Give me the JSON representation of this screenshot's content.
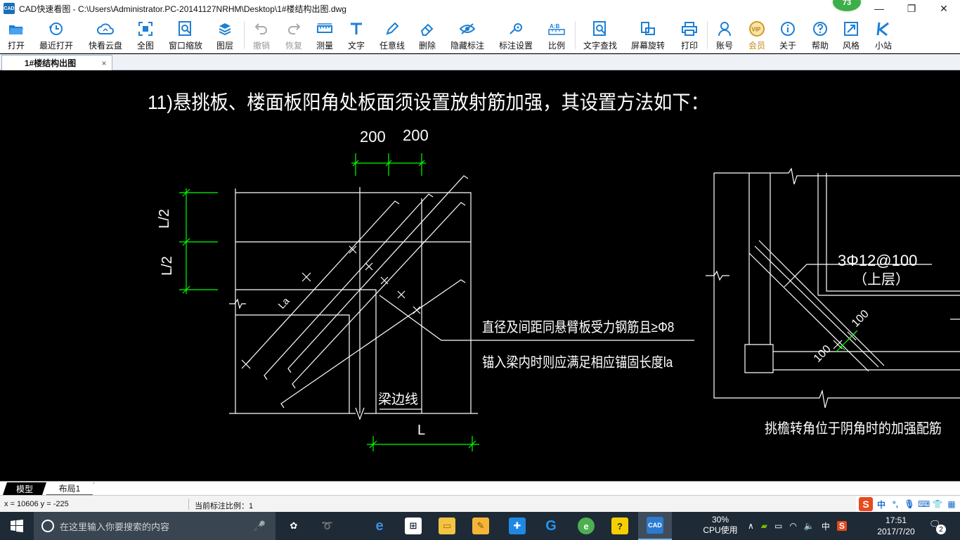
{
  "window": {
    "title": "CAD快速看图 - C:\\Users\\Administrator.PC-20141127NRHM\\Desktop\\1#楼结构出图.dwg",
    "badge": "73"
  },
  "toolbar": {
    "items": [
      {
        "label": "打开",
        "icon": "folder-open-icon"
      },
      {
        "label": "最近打开",
        "icon": "clock-icon"
      },
      {
        "label": "快看云盘",
        "icon": "cloud-icon"
      },
      {
        "label": "全图",
        "icon": "fit-all-icon"
      },
      {
        "label": "窗口缩放",
        "icon": "zoom-window-icon"
      },
      {
        "label": "图层",
        "icon": "layers-icon"
      },
      {
        "label": "撤销",
        "icon": "undo-icon"
      },
      {
        "label": "恢复",
        "icon": "redo-icon"
      },
      {
        "label": "测量",
        "icon": "ruler-icon"
      },
      {
        "label": "文字",
        "icon": "text-icon"
      },
      {
        "label": "任意线",
        "icon": "pen-icon"
      },
      {
        "label": "删除",
        "icon": "eraser-icon"
      },
      {
        "label": "隐藏标注",
        "icon": "eye-hide-icon"
      },
      {
        "label": "标注设置",
        "icon": "gear-icon"
      },
      {
        "label": "比例",
        "icon": "scale-icon"
      },
      {
        "label": "文字查找",
        "icon": "text-search-icon"
      },
      {
        "label": "屏幕旋转",
        "icon": "rotate-screen-icon"
      },
      {
        "label": "打印",
        "icon": "printer-icon"
      },
      {
        "label": "账号",
        "icon": "user-icon"
      },
      {
        "label": "会员",
        "icon": "vip-icon"
      },
      {
        "label": "关于",
        "icon": "info-icon"
      },
      {
        "label": "帮助",
        "icon": "help-icon"
      },
      {
        "label": "风格",
        "icon": "style-icon"
      },
      {
        "label": "小站",
        "icon": "k-logo-icon"
      }
    ],
    "vip_icon_text": "VIP",
    "scale_icon_text": "A:B"
  },
  "tabs": {
    "active": "1#楼结构出图",
    "close": "×"
  },
  "drawing": {
    "title": "11)悬挑板、楼面板阳角处板面须设置放射筋加强，其设置方法如下：",
    "dim_200_a": "200",
    "dim_200_b": "200",
    "dim_l2_top": "L/2",
    "dim_l2_bottom": "L/2",
    "dim_l": "L",
    "dim_la": "La",
    "beam_edge": "梁边线",
    "note_line1": "直径及间距同悬臂板受力钢筋且≥Φ8",
    "note_line2": "锚入梁内时则应满足相应锚固长度la",
    "right_rebar": "3Φ12@100",
    "right_rebar_layer": "（上层）",
    "right_dim_100_a": "100",
    "right_dim_100_b": "100",
    "right_caption": "挑檐转角位于阴角时的加强配筋"
  },
  "layout_tabs": {
    "model": "模型",
    "layout1": "布局1"
  },
  "status": {
    "coords": "x = 10606  y = -225",
    "scale": "当前标注比例：1"
  },
  "ime": {
    "lang": "中",
    "punct": "°,",
    "s_logo": "S"
  },
  "taskbar": {
    "search_placeholder": "在这里输入你要搜索的内容",
    "cpu_percent": "30%",
    "cpu_label": "CPU使用",
    "tray_lang": "中",
    "time": "17:51",
    "date": "2017/7/20",
    "notifications": "2"
  },
  "colors": {
    "canvas_bg": "#000000",
    "drawing_white": "#ffffff",
    "dimension_green": "#00ff00",
    "taskbar_bg": "#1e2a36",
    "toolbar_icon_blue": "#1d7fd6"
  }
}
